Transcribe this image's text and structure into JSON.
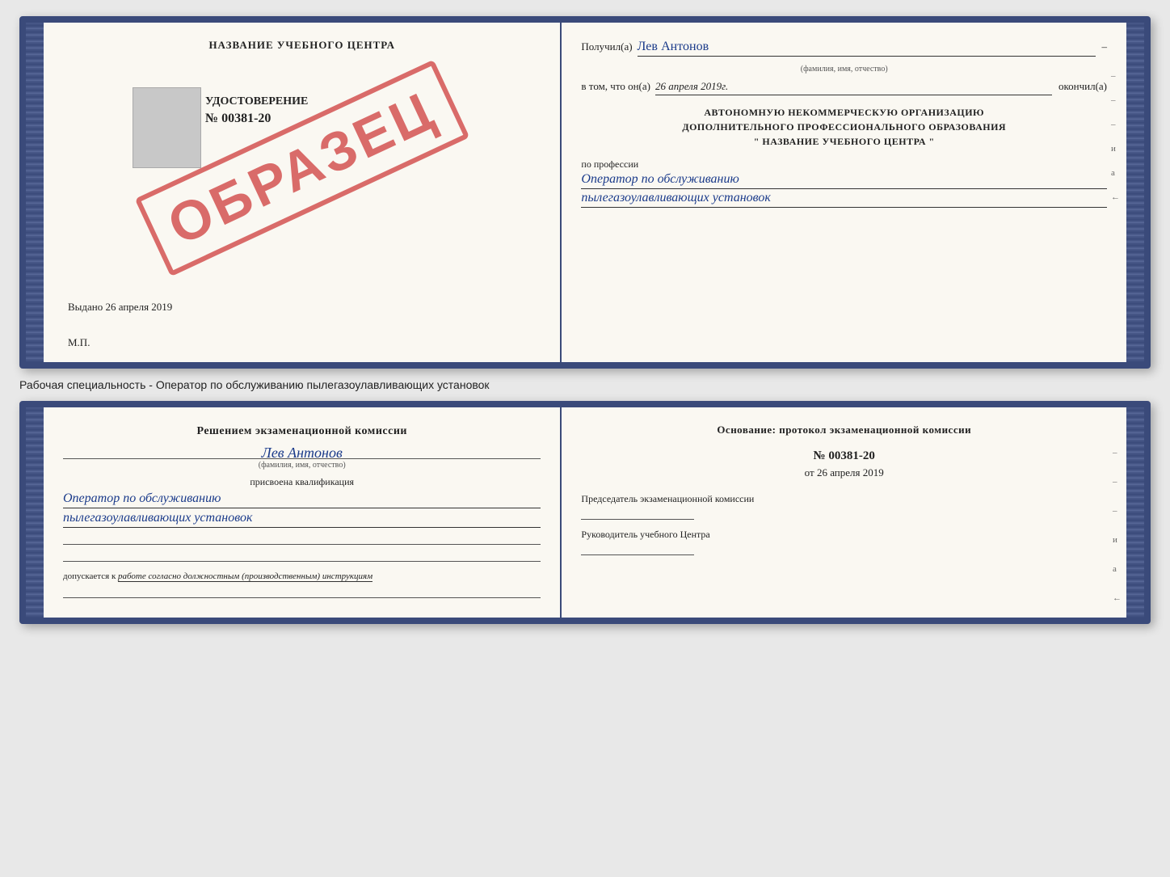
{
  "top_book": {
    "left_page": {
      "title": "НАЗВАНИЕ УЧЕБНОГО ЦЕНТРА",
      "stamp_text": "ОБРАЗЕЦ",
      "udostoverenie": "УДОСТОВЕРЕНИЕ",
      "number": "№ 00381-20",
      "vydano_label": "Выдано",
      "vydano_date": "26 апреля 2019",
      "mp": "М.П."
    },
    "right_page": {
      "poluchil_label": "Получил(а)",
      "fio_value": "Лев Антонов",
      "fio_sub": "(фамилия, имя, отчество)",
      "dash": "–",
      "vtom_label": "в том, что он(а)",
      "date_value": "26 апреля 2019г.",
      "okonchil": "окончил(а)",
      "org_line1": "АВТОНОМНУЮ НЕКОММЕРЧЕСКУЮ ОРГАНИЗАЦИЮ",
      "org_line2": "ДОПОЛНИТЕЛЬНОГО ПРОФЕССИОНАЛЬНОГО ОБРАЗОВАНИЯ",
      "org_line3": "\"  НАЗВАНИЕ УЧЕБНОГО ЦЕНТРА  \"",
      "po_professii": "по профессии",
      "profession_line1": "Оператор по обслуживанию",
      "profession_line2": "пылегазоулавливающих установок",
      "side_marks": [
        "–",
        "–",
        "–",
        "и",
        "а",
        "←"
      ]
    }
  },
  "specialty_text": "Рабочая специальность - Оператор по обслуживанию пылегазоулавливающих установок",
  "bottom_book": {
    "left_page": {
      "resheniem_line1": "Решением экзаменационной комиссии",
      "fio_value": "Лев Антонов",
      "fio_sub": "(фамилия, имя, отчество)",
      "prisvoena": "присвоена квалификация",
      "qualification_line1": "Оператор по обслуживанию",
      "qualification_line2": "пылегазоулавливающих установок",
      "dopuskaetsya_prefix": "допускается к",
      "dopuskaetsya_italic": "работе согласно должностным (производственным) инструкциям"
    },
    "right_page": {
      "osnov_label": "Основание: протокол экзаменационной комиссии",
      "protocol_number": "№  00381-20",
      "ot_label": "от",
      "ot_date": "26 апреля 2019",
      "predsedatel_label": "Председатель экзаменационной комиссии",
      "rukovoditel_label": "Руководитель учебного Центра",
      "side_marks": [
        "–",
        "–",
        "–",
        "и",
        "а",
        "←",
        "–",
        "–"
      ]
    }
  }
}
